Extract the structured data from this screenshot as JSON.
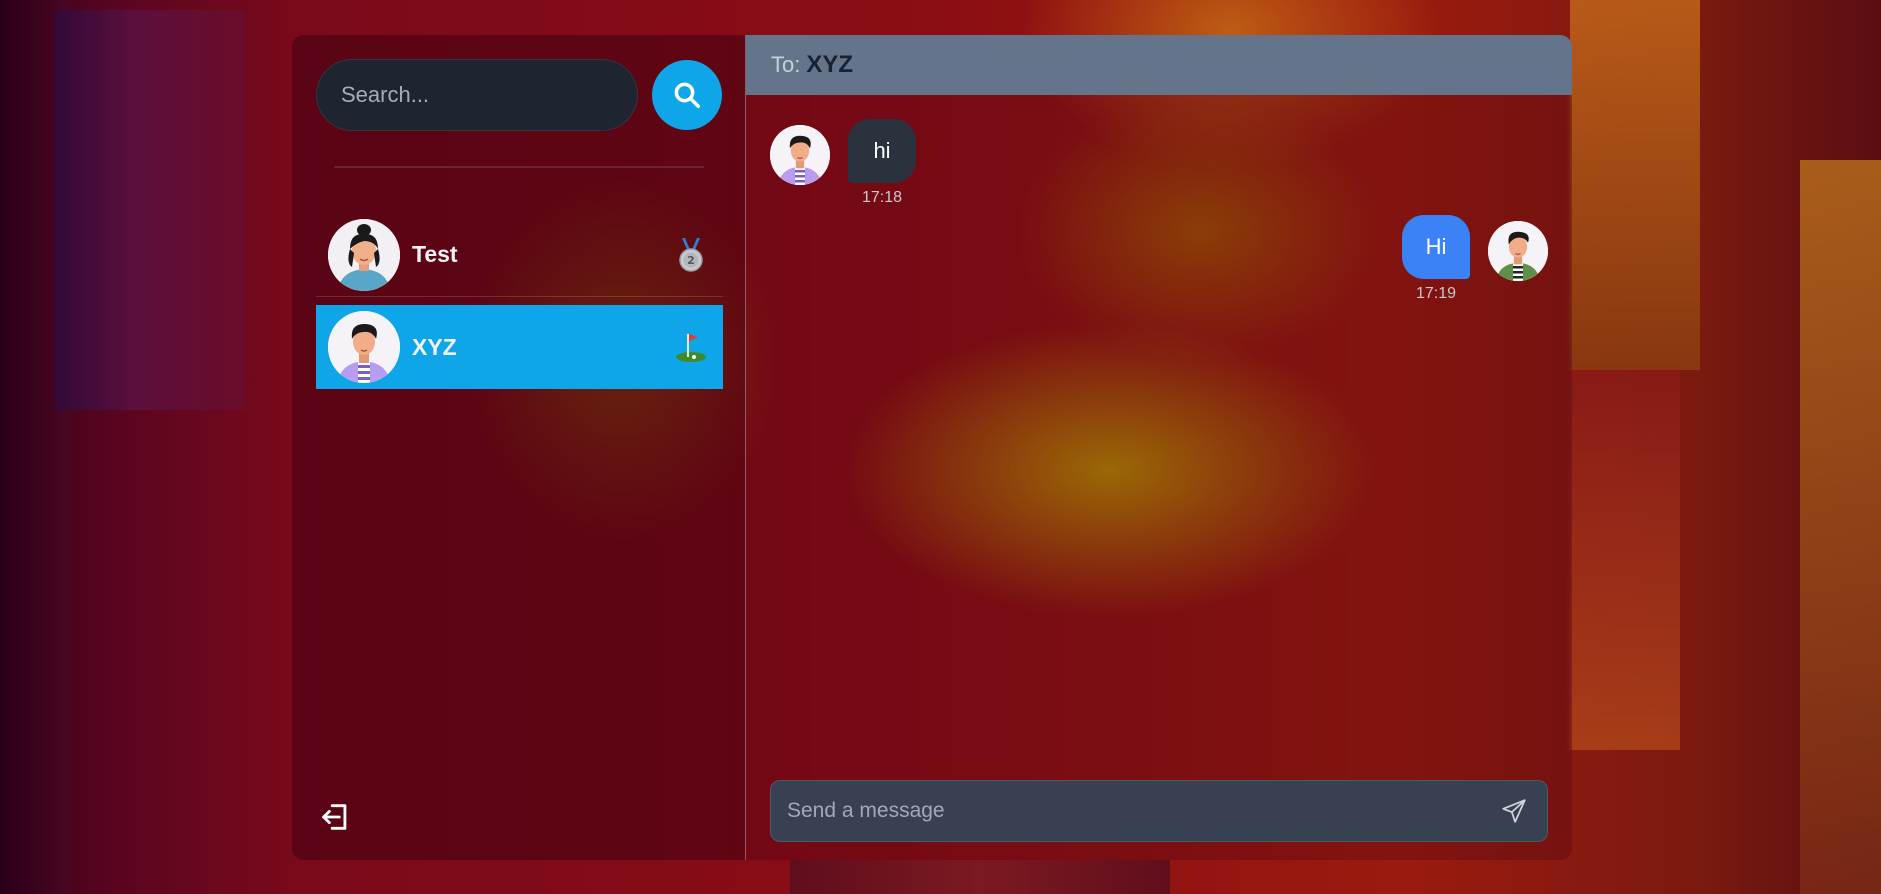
{
  "search": {
    "placeholder": "Search..."
  },
  "contacts": [
    {
      "name": "Test",
      "badge_icon": "second-place-medal-icon"
    },
    {
      "name": "XYZ",
      "badge_icon": "golf-flag-icon",
      "selected": true
    }
  ],
  "chat": {
    "to_label": "To:",
    "to_name": "XYZ",
    "messages": [
      {
        "text": "hi",
        "time": "17:18",
        "side": "received"
      },
      {
        "text": "Hi",
        "time": "17:19",
        "side": "sent"
      }
    ],
    "composer_placeholder": "Send a message"
  },
  "colors": {
    "accent": "#0ea5e9",
    "header": "#64748b",
    "sent_bubble": "#3b82f6",
    "received_bubble": "#2a323d",
    "composer": "#374151"
  }
}
